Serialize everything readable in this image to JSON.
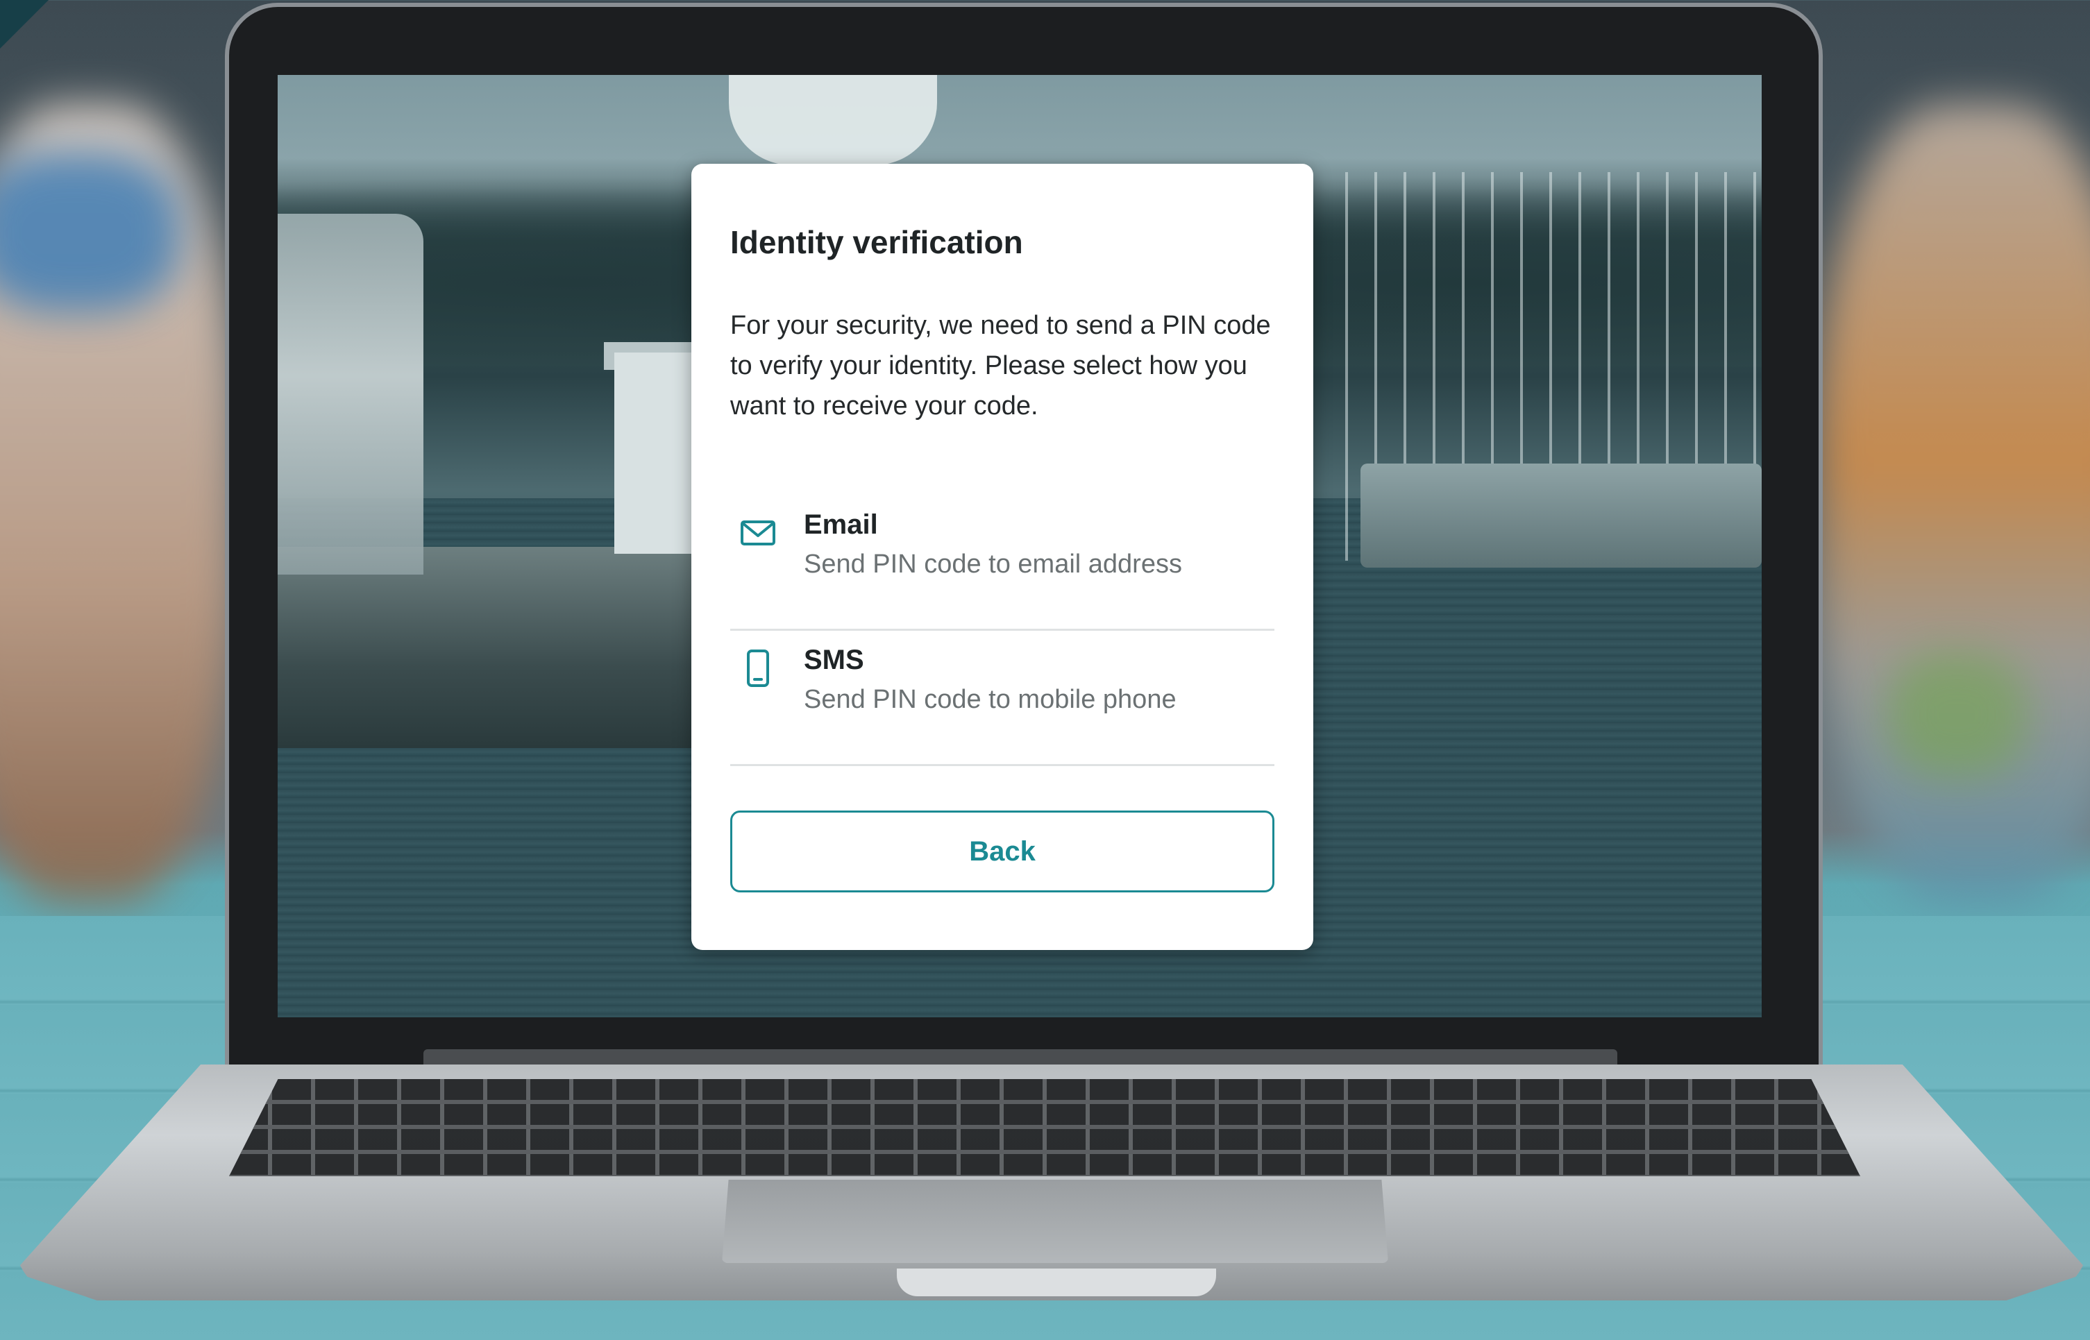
{
  "dialog": {
    "title": "Identity verification",
    "description": "For your security, we need to send a PIN code to verify your identity. Please select how you want to receive your code.",
    "options": [
      {
        "icon": "mail-icon",
        "label": "Email",
        "description": "Send PIN code to email address"
      },
      {
        "icon": "mobile-phone-icon",
        "label": "SMS",
        "description": "Send PIN code to mobile phone"
      }
    ],
    "back_label": "Back"
  },
  "colors": {
    "accent": "#1b8a93",
    "text_primary": "#1f2426",
    "text_secondary": "#6b7173",
    "divider": "#dfe2e3"
  }
}
